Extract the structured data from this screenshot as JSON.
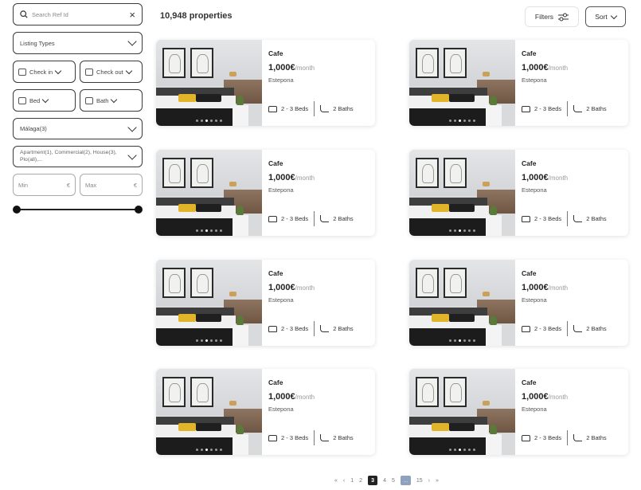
{
  "sidebar": {
    "search_placeholder": "Search Ref Id",
    "listing_types": "Listing Types",
    "check_in": "Check in",
    "check_out": "Check out",
    "bed": "Bed",
    "bath": "Bath",
    "location": "Málaga(3)",
    "property_types": "Apartment(1), Commercial(2), House(3), Plo(all),...",
    "min_label": "Min",
    "max_label": "Max",
    "currency": "€"
  },
  "header": {
    "count": "10,948 properties",
    "filters_label": "Filters",
    "sort_label": "Sort"
  },
  "listings": [
    {
      "title": "Cafe",
      "price": "1,000€",
      "per": "/month",
      "location": "Estepona",
      "beds": "2 - 3 Beds",
      "baths": "2 Baths"
    },
    {
      "title": "Cafe",
      "price": "1,000€",
      "per": "/month",
      "location": "Estepona",
      "beds": "2 - 3 Beds",
      "baths": "2 Baths"
    },
    {
      "title": "Cafe",
      "price": "1,000€",
      "per": "/month",
      "location": "Estepona",
      "beds": "2 - 3 Beds",
      "baths": "2 Baths"
    },
    {
      "title": "Cafe",
      "price": "1,000€",
      "per": "/month",
      "location": "Estepona",
      "beds": "2 - 3 Beds",
      "baths": "2 Baths"
    },
    {
      "title": "Cafe",
      "price": "1,000€",
      "per": "/month",
      "location": "Estepona",
      "beds": "2 - 3 Beds",
      "baths": "2 Baths"
    },
    {
      "title": "Cafe",
      "price": "1,000€",
      "per": "/month",
      "location": "Estepona",
      "beds": "2 - 3 Beds",
      "baths": "2 Baths"
    },
    {
      "title": "Cafe",
      "price": "1,000€",
      "per": "/month",
      "location": "Estepona",
      "beds": "2 - 3 Beds",
      "baths": "2 Baths"
    },
    {
      "title": "Cafe",
      "price": "1,000€",
      "per": "/month",
      "location": "Estepona",
      "beds": "2 - 3 Beds",
      "baths": "2 Baths"
    }
  ],
  "pagination": {
    "first": "«",
    "prev": "‹",
    "pages": [
      "1",
      "2",
      "3",
      "4",
      "5"
    ],
    "current": "3",
    "ellipsis": "...",
    "last_page": "15",
    "next": "›",
    "last": "»"
  }
}
